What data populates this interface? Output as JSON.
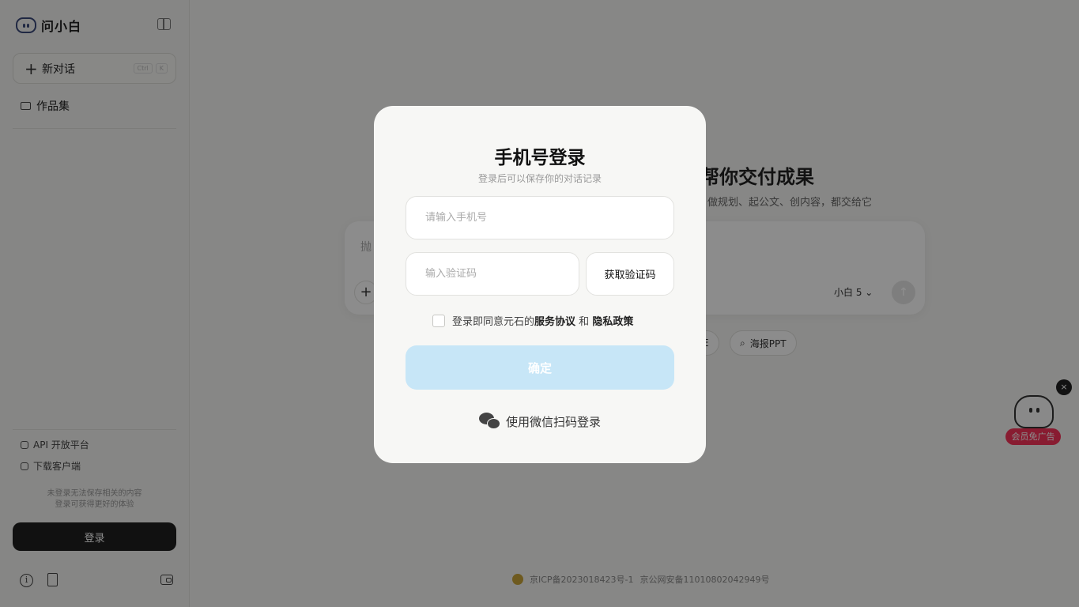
{
  "sidebar": {
    "brand": "问小白",
    "new_chat": "新对话",
    "kbd_ctrl": "Ctrl",
    "kbd_k": "K",
    "works": "作品集",
    "api_platform": "API 开放平台",
    "download_client": "下载客户端",
    "guest_note_line1": "未登录无法保存相关的内容",
    "guest_note_line2": "登录可获得更好的体验",
    "login_button": "登录",
    "info_glyph": "i"
  },
  "main": {
    "headline": "帮你交付成果",
    "subline": "做规划、起公文、创内容，都交给它",
    "composer_placeholder": "抛",
    "model_selector": "小白 5",
    "chip_right": "海报PPT",
    "chip_left_fragment": "E",
    "footer_icp": "京ICP备2023018423号-1",
    "footer_police": "京公网安备11010802042949号"
  },
  "ad": {
    "label": "会员免广告",
    "close_glyph": "×"
  },
  "login_modal": {
    "title": "手机号登录",
    "subtitle": "登录后可以保存你的对话记录",
    "phone_placeholder": "请输入手机号",
    "code_placeholder": "输入验证码",
    "get_code": "获取验证码",
    "agree_prefix": "登录即同意元石的",
    "service_agreement": "服务协议",
    "agree_and": "和",
    "privacy_policy": "隐私政策",
    "confirm": "确定",
    "wechat_login": "使用微信扫码登录"
  },
  "colors": {
    "confirm_bg": "#c7e6f7",
    "login_side_bg": "#1f1f1f",
    "ad_label_bg": "#f7345a",
    "overlay": "rgba(0,0,0,0.45)"
  },
  "icons": [
    "logo-icon",
    "sidebar-toggle-icon",
    "plus-icon",
    "folder-icon",
    "api-icon",
    "download-icon",
    "info-icon",
    "document-icon",
    "wallet-icon",
    "send-icon",
    "search-icon",
    "wechat-icon",
    "close-icon",
    "police-badge-icon"
  ]
}
